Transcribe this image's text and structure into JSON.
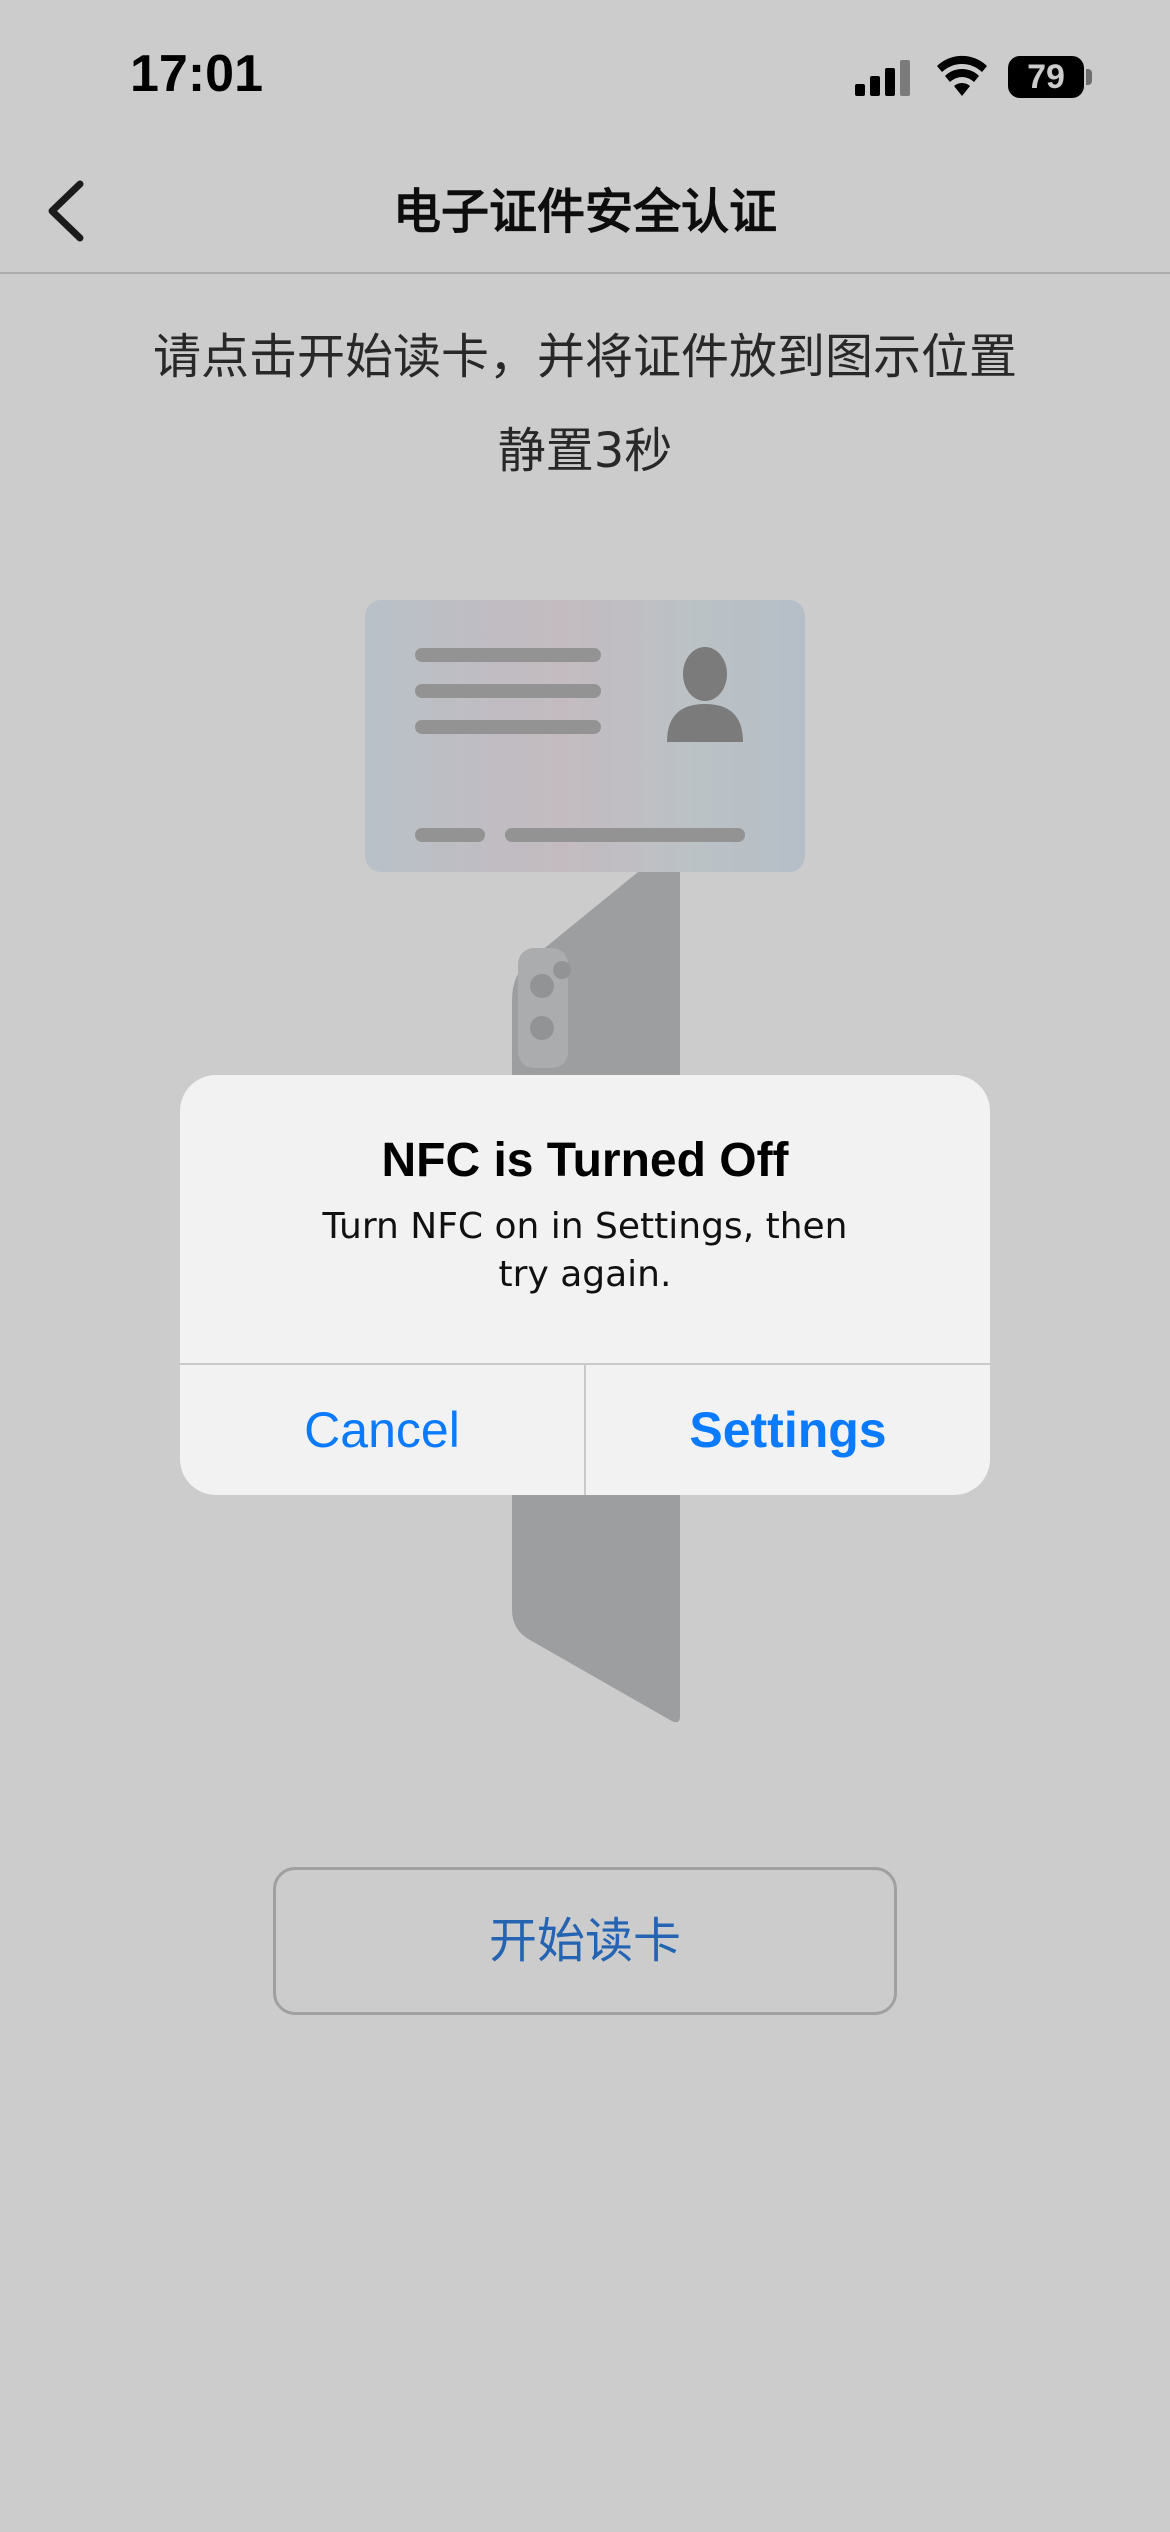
{
  "status_bar": {
    "time": "17:01",
    "battery": "79",
    "icons": [
      "signal-icon",
      "wifi-icon",
      "battery-icon"
    ]
  },
  "nav": {
    "back_icon": "chevron-left-icon",
    "title": "电子证件安全认证"
  },
  "instruction": {
    "line1": "请点击开始读卡，并将证件放到图示位置",
    "line2": "静置3秒"
  },
  "illustration": {
    "icons": [
      "id-card-illustration",
      "person-avatar-icon",
      "phone-illustration"
    ]
  },
  "start_button": {
    "label": "开始读卡"
  },
  "alert": {
    "title": "NFC is Turned Off",
    "message_line1": "Turn NFC on in Settings, then",
    "message_line2": "try again.",
    "cancel_label": "Cancel",
    "settings_label": "Settings"
  },
  "colors": {
    "accent": "#0a7aff",
    "button_text": "#2f7de0",
    "overlay": "rgba(0,0,0,0.2)"
  }
}
